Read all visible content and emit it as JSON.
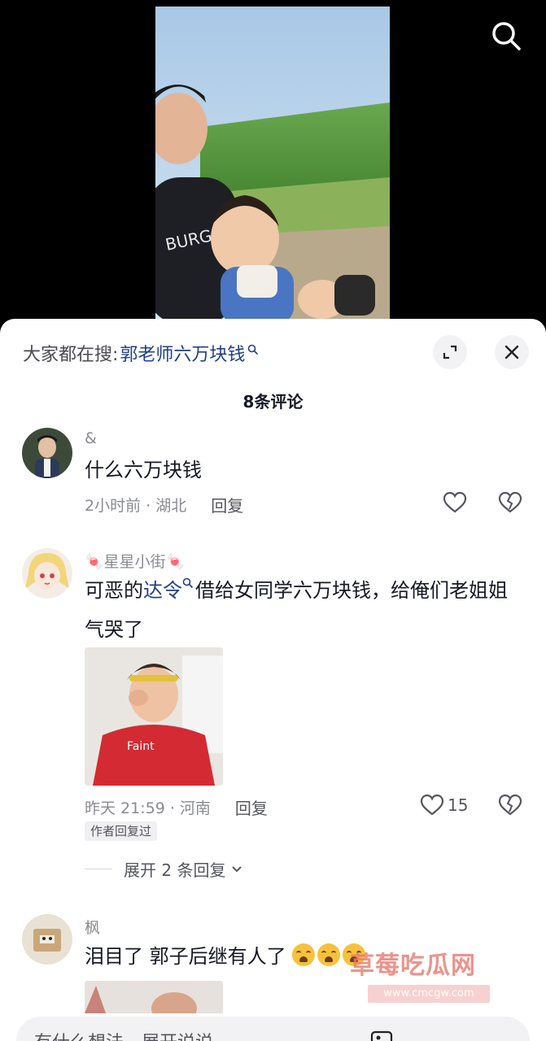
{
  "search": {
    "icon": "search-icon"
  },
  "sheet": {
    "trending_label": "大家都在搜:",
    "trending_query": "郭老师六万块钱",
    "comment_count": "8条评论"
  },
  "comments": [
    {
      "author": "&",
      "text": "什么六万块钱",
      "time_location": "2小时前 · 湖北",
      "reply_label": "回复",
      "likes": ""
    },
    {
      "author": "🍬星星小街🍬",
      "text_before_link": "可恶的",
      "text_link": "达令",
      "text_after_link": "借给女同学六万块钱，给俺们老姐姐气哭了",
      "time_location": "昨天 21:59 · 河南",
      "reply_label": "回复",
      "likes": "15",
      "badge": "作者回复过",
      "expand_replies": "展开 2 条回复"
    },
    {
      "author": "枫",
      "text": "泪目了 郭子后继有人了",
      "emoji_count": 3
    }
  ],
  "watermark": {
    "title": "草莓吃瓜网",
    "url": "www.cmcgw.com"
  },
  "input": {
    "placeholder": "有什么想法，展开说说"
  },
  "colors": {
    "link": "#1f3f8a",
    "muted": "#8a8b91",
    "sheet_bg": "#ffffff"
  }
}
